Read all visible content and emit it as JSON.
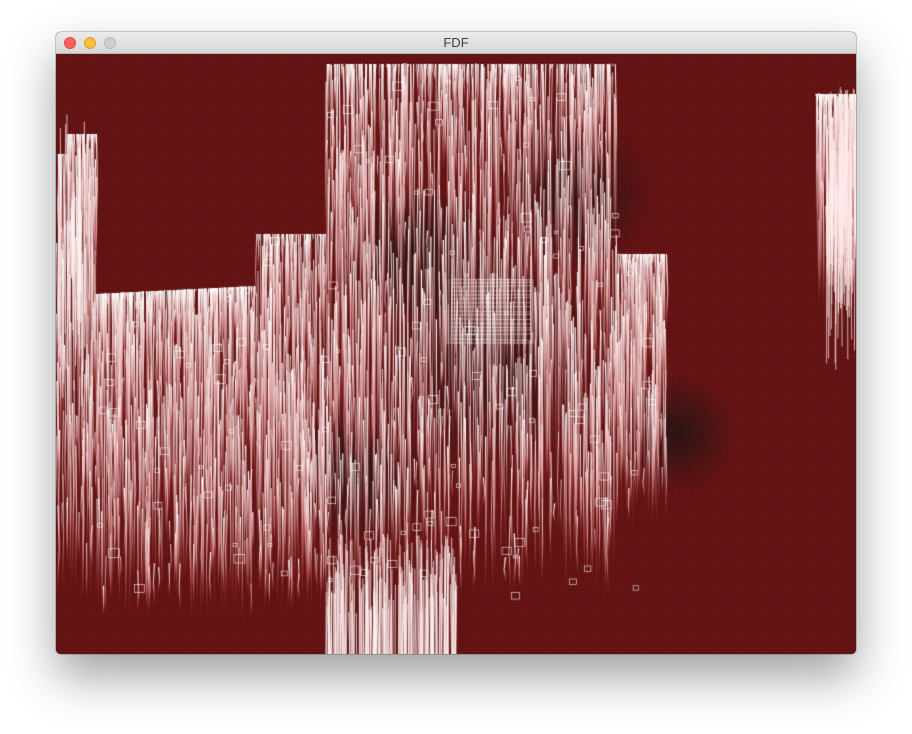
{
  "window": {
    "title": "FDF",
    "buttons": {
      "close": "close-icon",
      "minimize": "minimize-icon",
      "zoom": "zoom-icon"
    },
    "button_colors": {
      "close": "#fc605b",
      "minimize": "#fdbc40",
      "zoom": "#cfcfcf"
    }
  },
  "render": {
    "background_color": "#5a1212",
    "grid_color": "#c02a2a",
    "peak_color": "#ffffff",
    "shadow_color": "#231a1a"
  }
}
